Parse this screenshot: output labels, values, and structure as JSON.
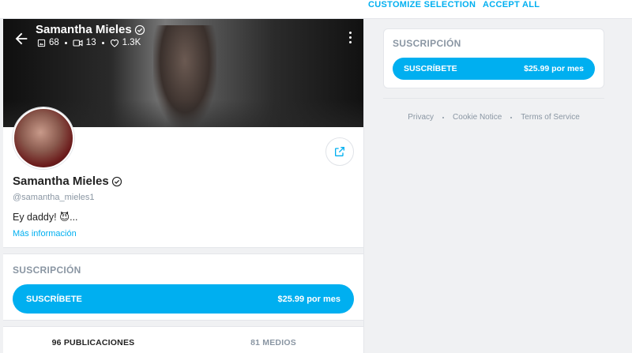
{
  "cookie_banner": {
    "customize_label": "CUSTOMIZE SELECTION",
    "accept_label": "ACCEPT ALL"
  },
  "cover": {
    "name": "Samantha Mieles",
    "stats": {
      "photos": "68",
      "videos": "13",
      "likes": "1.3K"
    }
  },
  "profile": {
    "name": "Samantha Mieles",
    "handle": "@samantha_mieles1",
    "bio": "Ey daddy! 😈...",
    "more_info": "Más información"
  },
  "subscription": {
    "title": "SUSCRIPCIÓN",
    "button_label": "SUSCRÍBETE",
    "price": "$25.99 por mes"
  },
  "tabs": [
    {
      "label": "96 PUBLICACIONES"
    },
    {
      "label": "81 MEDIOS"
    }
  ],
  "footer": {
    "links": [
      "Privacy",
      "Cookie Notice",
      "Terms of Service"
    ]
  },
  "colors": {
    "accent": "#00aff0",
    "muted": "#8a96a3",
    "background": "#f0f1f3"
  }
}
